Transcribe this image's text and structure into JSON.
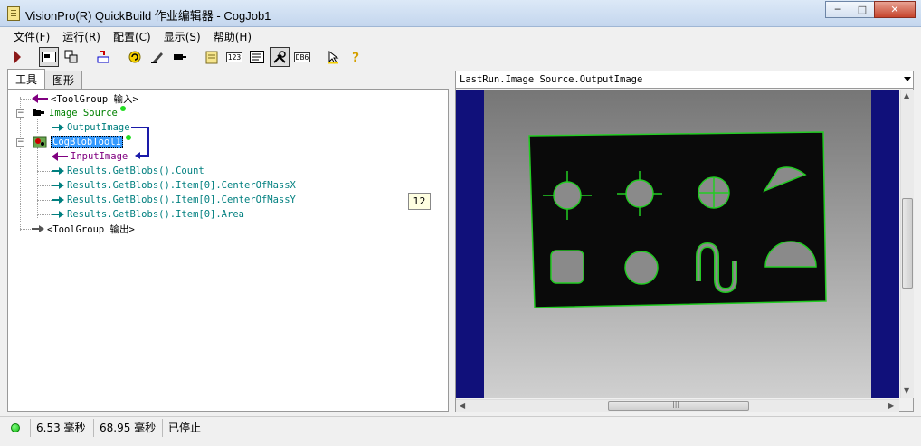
{
  "window": {
    "title": "VisionPro(R) QuickBuild 作业编辑器 - CogJob1",
    "buttons": [
      "─",
      "□",
      "✕"
    ]
  },
  "menu": [
    "文件(F)",
    "运行(R)",
    "配置(C)",
    "显示(S)",
    "帮助(H)"
  ],
  "toolbar": {
    "icons": [
      "run-icon",
      "show-job-icon",
      "tools-icon",
      "reset-icon",
      "refresh-icon",
      "edit-icon",
      "camera-icon",
      "notes-icon",
      "numbers-icon",
      "results-icon",
      "tool-icon",
      "db-icon",
      "pointer-icon",
      "help-icon"
    ],
    "numbers_text": "123",
    "db_text": "DB6"
  },
  "left": {
    "tabs": [
      "工具",
      "图形"
    ],
    "tree": {
      "input_group": "<ToolGroup 输入>",
      "image_source": "Image Source",
      "output_image": "OutputImage",
      "blob_tool": "CogBlobTool1",
      "input_image": "InputImage",
      "results": [
        "Results.GetBlobs().Count",
        "Results.GetBlobs().Item[0].CenterOfMassX",
        "Results.GetBlobs().Item[0].CenterOfMassY",
        "Results.GetBlobs().Item[0].Area"
      ],
      "output_group": "<ToolGroup 输出>"
    },
    "value_badge": "12"
  },
  "right": {
    "combo_value": "LastRun.Image Source.OutputImage",
    "hscroll_grip": "|||"
  },
  "status": {
    "time1": "6.53 毫秒",
    "time2": "68.95 毫秒",
    "state": "已停止"
  },
  "colors": {
    "accent_blue": "#3399ff",
    "blob_green": "#22cc22",
    "image_bg": "#10107a",
    "status_green": "#14b914"
  }
}
